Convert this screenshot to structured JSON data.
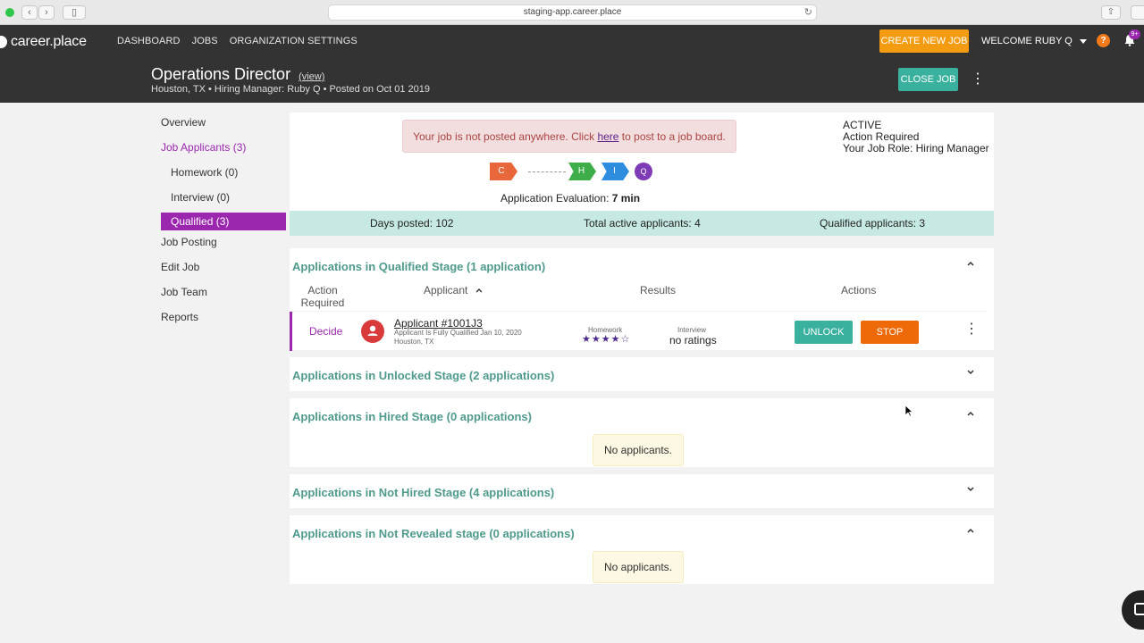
{
  "browser": {
    "url": "staging-app.career.place"
  },
  "nav": {
    "logo": "career.place",
    "items": [
      "DASHBOARD",
      "JOBS",
      "ORGANIZATION SETTINGS"
    ],
    "create_job": "CREATE NEW JOB",
    "welcome": "WELCOME RUBY Q",
    "help": "?",
    "notifications": "9+"
  },
  "job": {
    "title": "Operations Director",
    "view_link": "(view)",
    "meta": "Houston, TX • Hiring Manager: Ruby Q • Posted on Oct 01 2019",
    "close_button": "CLOSE JOB"
  },
  "sidebar": {
    "overview": "Overview",
    "job_applicants": "Job Applicants (3)",
    "homework": "Homework (0)",
    "interview": "Interview (0)",
    "qualified": "Qualified (3)",
    "job_posting": "Job Posting",
    "edit_job": "Edit Job",
    "job_team": "Job Team",
    "reports": "Reports"
  },
  "alert": {
    "before": "Your job is not posted anywhere. Click ",
    "link": "here",
    "after": " to post to a job board."
  },
  "status": {
    "state": "ACTIVE",
    "action": "Action Required",
    "role": "Your Job Role: Hiring Manager"
  },
  "pipeline": {
    "c": "C",
    "h": "H",
    "i": "I",
    "q": "Q"
  },
  "evaluation": {
    "label": "Application Evaluation: ",
    "value": "7 min"
  },
  "stats": {
    "days": "Days posted: 102",
    "active": "Total active applicants: 4",
    "qualified": "Qualified applicants: 3"
  },
  "sections": {
    "qualified": {
      "title": "Applications in Qualified Stage (1 application)",
      "col_action": "Action Required",
      "col_applicant": "Applicant",
      "col_results": "Results",
      "col_actions": "Actions",
      "row": {
        "decide": "Decide",
        "name": "Applicant #1001J3",
        "line1": "Applicant Is Fully Qualified Jan 10, 2020",
        "line2": "Houston, TX",
        "homework_label": "Homework",
        "stars": "★★★★☆",
        "interview_label": "Interview",
        "interview_value": "no ratings",
        "unlock": "UNLOCK",
        "stop": "STOP"
      }
    },
    "unlocked": {
      "title": "Applications in Unlocked Stage (2 applications)"
    },
    "hired": {
      "title": "Applications in Hired Stage (0 applications)",
      "empty": "No applicants."
    },
    "not_hired": {
      "title": "Applications in Not Hired Stage (4 applications)"
    },
    "not_revealed": {
      "title": "Applications in Not Revealed stage (0 applications)",
      "empty": "No applicants."
    }
  },
  "colors": {
    "accent": "#9b27af",
    "teal": "#3ab09e",
    "orange": "#f39c12",
    "header": "#333333"
  }
}
